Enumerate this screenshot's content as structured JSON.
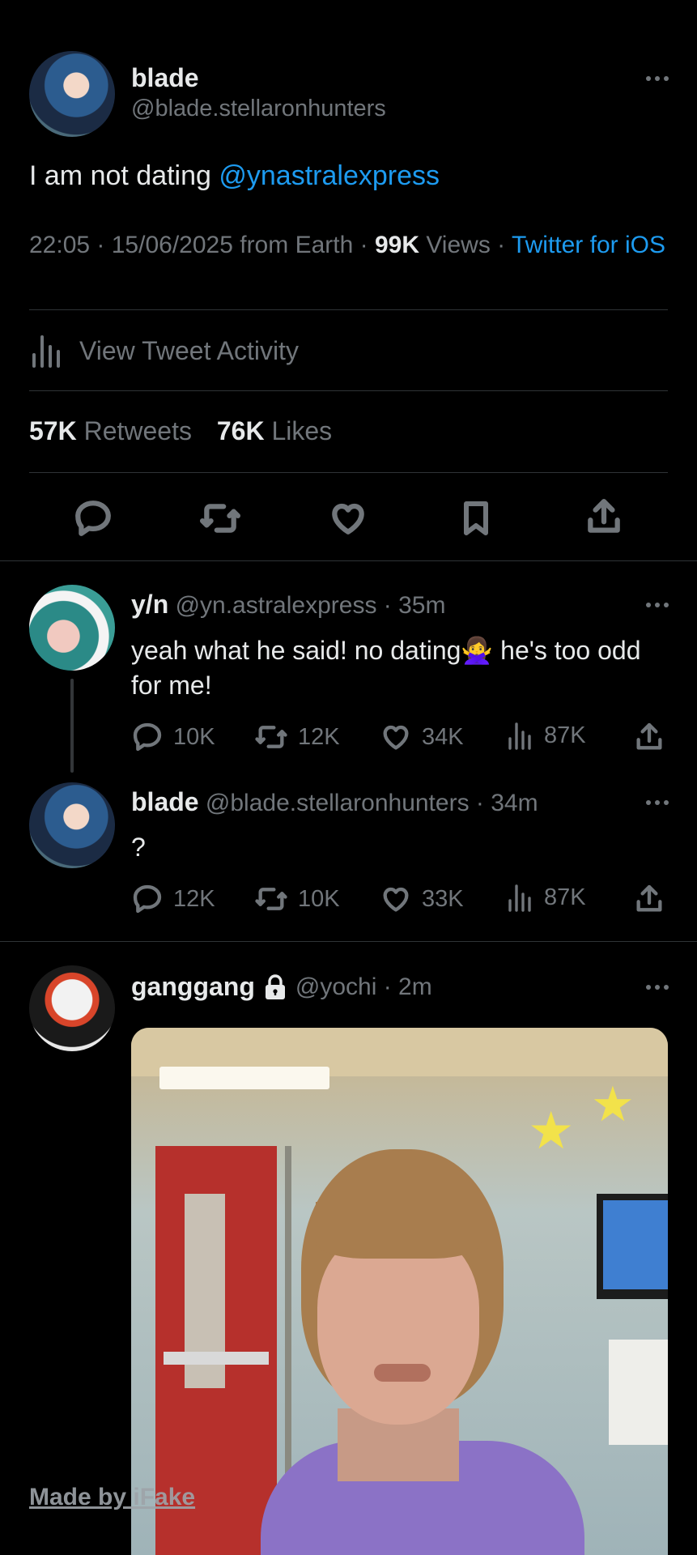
{
  "main_tweet": {
    "display_name": "blade",
    "handle": "@blade.stellaronhunters",
    "text_prefix": "I am not dating ",
    "mention": "@ynastralexpress",
    "time": "22:05",
    "sep1": " · ",
    "date": "15/06/2025 from Earth",
    "sep2": " · ",
    "views_count": "99K",
    "views_label": " Views",
    "sep3": " · ",
    "client": "Twitter for iOS",
    "activity_label": "View Tweet Activity",
    "retweets_count": "57K",
    "retweets_label": " Retweets",
    "likes_count": "76K",
    "likes_label": " Likes"
  },
  "replies": [
    {
      "display_name": "y/n",
      "handle": "@yn.astralexpress · 35m",
      "text": "yeah what he said! no dating🙅‍♀️ he's too odd for me!",
      "replies": "10K",
      "retweets": "12K",
      "likes": "34K",
      "views": "87K"
    },
    {
      "display_name": "blade",
      "handle": "@blade.stellaronhunters · 34m",
      "text": "?",
      "replies": "12K",
      "retweets": "10K",
      "likes": "33K",
      "views": "87K"
    },
    {
      "display_name": "ganggang",
      "handle": "@yochi · 2m"
    }
  ],
  "watermark": "Made by iFake",
  "colors": {
    "background": "#000000",
    "text": "#e7e9ea",
    "muted": "#71767b",
    "link": "#1d9bf0",
    "divider": "#2f3336"
  }
}
